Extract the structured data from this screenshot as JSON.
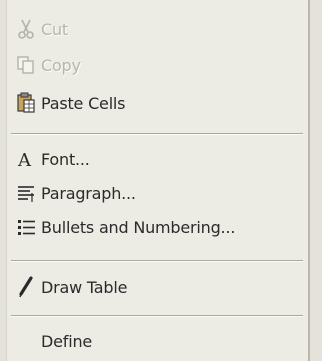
{
  "menu": {
    "items": [
      {
        "label": "Cut",
        "icon": "scissors-icon",
        "enabled": false
      },
      {
        "label": "Copy",
        "icon": "copy-icon",
        "enabled": false
      },
      {
        "label": "Paste Cells",
        "icon": "paste-icon",
        "enabled": true
      },
      {
        "label": "Font...",
        "icon": "font-icon",
        "enabled": true
      },
      {
        "label": "Paragraph...",
        "icon": "paragraph-icon",
        "enabled": true
      },
      {
        "label": "Bullets and Numbering...",
        "icon": "bullets-icon",
        "enabled": true
      },
      {
        "label": "Draw Table",
        "icon": "pencil-icon",
        "enabled": true
      },
      {
        "label": "Define",
        "icon": "",
        "enabled": true
      }
    ]
  }
}
